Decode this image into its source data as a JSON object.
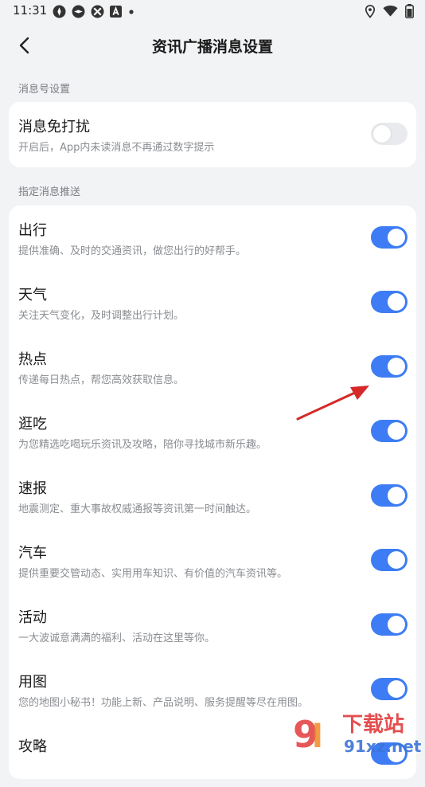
{
  "status_bar": {
    "time": "11:31",
    "icons": [
      "app-icon",
      "app-icon",
      "app-icon",
      "a-icon",
      "dot-icon"
    ],
    "right_icons": [
      "location-icon",
      "wifi-icon",
      "battery-icon"
    ]
  },
  "header": {
    "back_icon": "chevron-left-icon",
    "title": "资讯广播消息设置"
  },
  "sections": [
    {
      "label": "消息号设置",
      "items": [
        {
          "title": "消息免打扰",
          "desc": "开启后，App内未读消息不再通过数字提示",
          "enabled": false
        }
      ]
    },
    {
      "label": "指定消息推送",
      "items": [
        {
          "title": "出行",
          "desc": "提供准确、及时的交通资讯，做您出行的好帮手。",
          "enabled": true
        },
        {
          "title": "天气",
          "desc": "关注天气变化，及时调整出行计划。",
          "enabled": true
        },
        {
          "title": "热点",
          "desc": "传递每日热点，帮您高效获取信息。",
          "enabled": true
        },
        {
          "title": "逛吃",
          "desc": "为您精选吃喝玩乐资讯及攻略，陪你寻找城市新乐趣。",
          "enabled": true
        },
        {
          "title": "速报",
          "desc": "地震测定、重大事故权威通报等资讯第一时间触达。",
          "enabled": true
        },
        {
          "title": "汽车",
          "desc": "提供重要交管动态、实用用车知识、有价值的汽车资讯等。",
          "enabled": true
        },
        {
          "title": "活动",
          "desc": "一大波诚意满满的福利、活动在这里等你。",
          "enabled": true
        },
        {
          "title": "用图",
          "desc": "您的地图小秘书！功能上新、产品说明、服务提醒等尽在用图。",
          "enabled": true
        },
        {
          "title": "攻略",
          "desc": "",
          "enabled": true
        }
      ]
    }
  ],
  "colors": {
    "accent": "#3d7cf4",
    "background": "#f2f3f5",
    "toggle_off": "#e9eaed",
    "arrow": "#d62828"
  },
  "watermark": {
    "text_top": "下载站",
    "text_bottom": "91xz.net"
  }
}
